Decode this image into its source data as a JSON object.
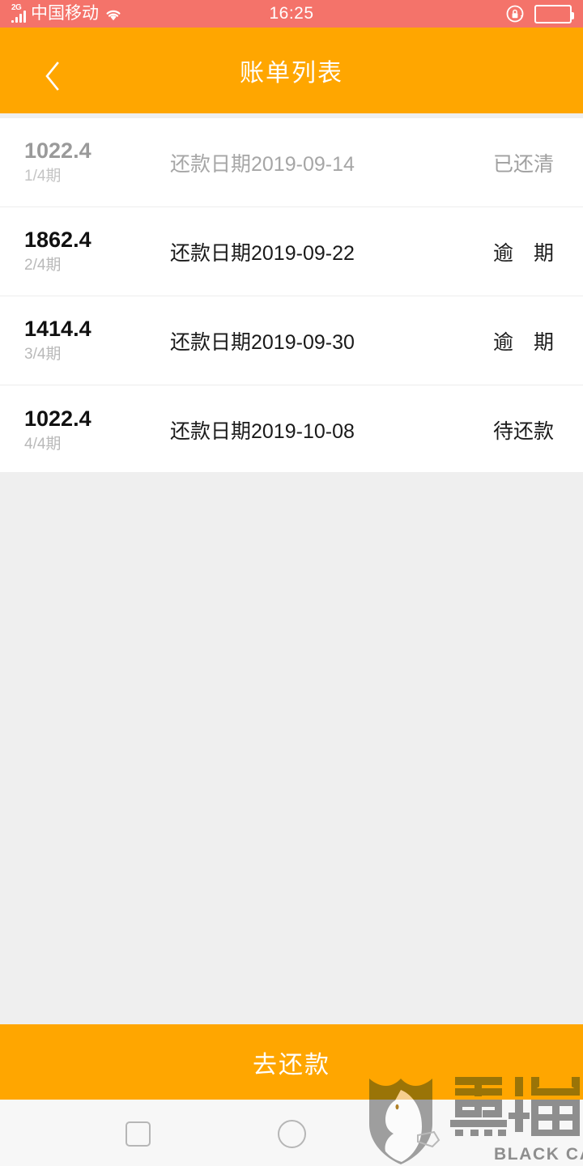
{
  "statusbar": {
    "network_type": "2G",
    "carrier": "中国移动",
    "time": "16:25",
    "wifi_icon": "wifi-icon",
    "rotation_lock_icon": "rotation-lock-icon",
    "battery_icon": "battery-icon"
  },
  "header": {
    "back_icon": "chevron-left-icon",
    "title": "账单列表",
    "background_color": "#ffa600"
  },
  "list": {
    "rows": [
      {
        "amount": "1022.4",
        "term": "1/4期",
        "date": "还款日期2019-09-14",
        "status": "已还清",
        "state": "paid"
      },
      {
        "amount": "1862.4",
        "term": "2/4期",
        "date": "还款日期2019-09-22",
        "status": "逾　期",
        "state": "overdue"
      },
      {
        "amount": "1414.4",
        "term": "3/4期",
        "date": "还款日期2019-09-30",
        "status": "逾　期",
        "state": "overdue"
      },
      {
        "amount": "1022.4",
        "term": "4/4期",
        "date": "还款日期2019-10-08",
        "status": "待还款",
        "state": "pending"
      }
    ]
  },
  "footer": {
    "pay_button_label": "去还款"
  },
  "navbar": {
    "recents_icon": "square-recents-icon",
    "home_icon": "circle-home-icon"
  },
  "watermark": {
    "brand_cn": "黑猫",
    "brand_en": "BLACK CAT",
    "shield_icon": "shield-cat-icon"
  },
  "colors": {
    "status_bar": "#f4736a",
    "accent_orange": "#ffa600",
    "page_background": "#efefef",
    "muted_text": "#a0a0a0"
  }
}
